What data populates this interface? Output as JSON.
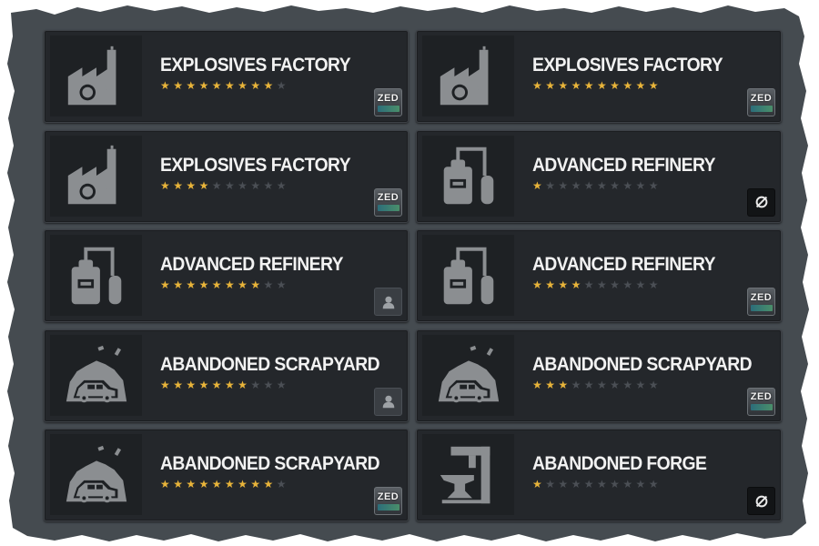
{
  "cards": [
    {
      "title": "EXPLOSIVES FACTORY",
      "rating": 9,
      "max_rating": 10,
      "icon": "explosives-factory-icon",
      "badge": "zed",
      "badge_text": "ZED"
    },
    {
      "title": "EXPLOSIVES FACTORY",
      "rating": 10,
      "max_rating": 10,
      "icon": "explosives-factory-icon",
      "badge": "zed",
      "badge_text": "ZED"
    },
    {
      "title": "EXPLOSIVES FACTORY",
      "rating": 4,
      "max_rating": 10,
      "icon": "explosives-factory-icon",
      "badge": "zed",
      "badge_text": "ZED"
    },
    {
      "title": "ADVANCED REFINERY",
      "rating": 1,
      "max_rating": 10,
      "icon": "refinery-icon",
      "badge": "none",
      "badge_text": ""
    },
    {
      "title": "ADVANCED REFINERY",
      "rating": 8,
      "max_rating": 10,
      "icon": "refinery-icon",
      "badge": "user",
      "badge_text": ""
    },
    {
      "title": "ADVANCED REFINERY",
      "rating": 4,
      "max_rating": 10,
      "icon": "refinery-icon",
      "badge": "zed",
      "badge_text": "ZED"
    },
    {
      "title": "ABANDONED SCRAPYARD",
      "rating": 7,
      "max_rating": 10,
      "icon": "scrapyard-icon",
      "badge": "user",
      "badge_text": ""
    },
    {
      "title": "ABANDONED SCRAPYARD",
      "rating": 3,
      "max_rating": 10,
      "icon": "scrapyard-icon",
      "badge": "zed",
      "badge_text": "ZED"
    },
    {
      "title": "ABANDONED SCRAPYARD",
      "rating": 9,
      "max_rating": 10,
      "icon": "scrapyard-icon",
      "badge": "zed",
      "badge_text": "ZED"
    },
    {
      "title": "ABANDONED FORGE",
      "rating": 1,
      "max_rating": 10,
      "icon": "forge-icon",
      "badge": "none",
      "badge_text": ""
    }
  ],
  "colors": {
    "star_on": "#e8b43a",
    "star_off": "#4b4f55",
    "card_bg": "#24272b",
    "frame_bg": "#454b50"
  }
}
